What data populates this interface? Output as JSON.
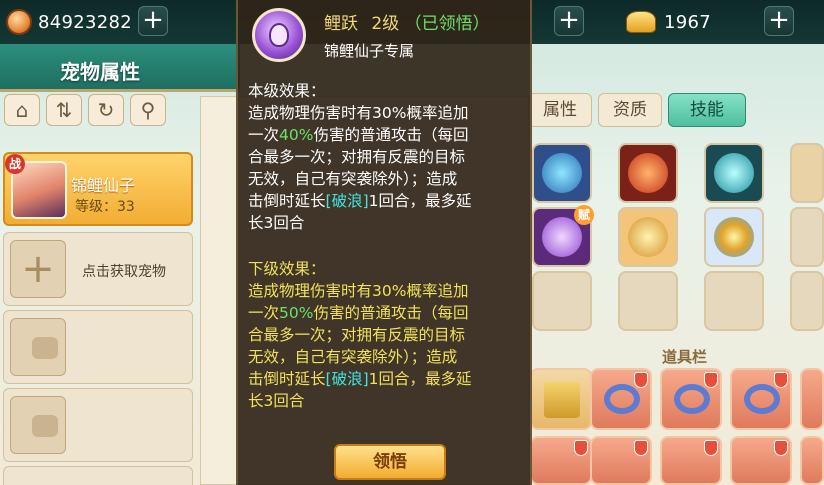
{
  "topbar": {
    "coins": "84923282",
    "gold": "1967"
  },
  "header": {
    "title": "宠物属性"
  },
  "pet_list": {
    "selected_pet": {
      "badge": "战",
      "name": "锦鲤仙子",
      "level": "等级：33"
    },
    "add_pet_label": "点击获取宠物"
  },
  "tabs": [
    "属性",
    "资质",
    "技能"
  ],
  "active_tab": "技能",
  "items_section_title": "道具栏",
  "skill_badge": "赋",
  "popup": {
    "skill_name": "鲤跃",
    "skill_level": "2级",
    "skill_state": "（已领悟）",
    "subtitle": "锦鲤仙子专属",
    "current_title": "本级效果：",
    "current_effect": {
      "line1": "造成物理伤害时有30%概率追加",
      "line2_a": "一次",
      "line2_pct": "40%",
      "line2_b": "伤害的普通攻击（每回",
      "line3": "合最多一次；对拥有反震的目标",
      "line4": "无效，自己有突袭除外）；造成",
      "line5_a": "击倒时延长",
      "line5_kw": "[破浪]",
      "line5_b": "1回合，最多延",
      "line6": "长3回合"
    },
    "next_title": "下级效果：",
    "next_effect": {
      "line1": "造成物理伤害时有30%概率追加",
      "line2_a": "一次",
      "line2_pct": "50%",
      "line2_b": "伤害的普通攻击（每回",
      "line3": "合最多一次；对拥有反震的目标",
      "line4": "无效，自己有突袭除外）；造成",
      "line5_a": "击倒时延长",
      "line5_kw": "[破浪]",
      "line5_b": "1回合，最多延",
      "line6": "长3回合"
    },
    "learn_button": "领悟"
  }
}
